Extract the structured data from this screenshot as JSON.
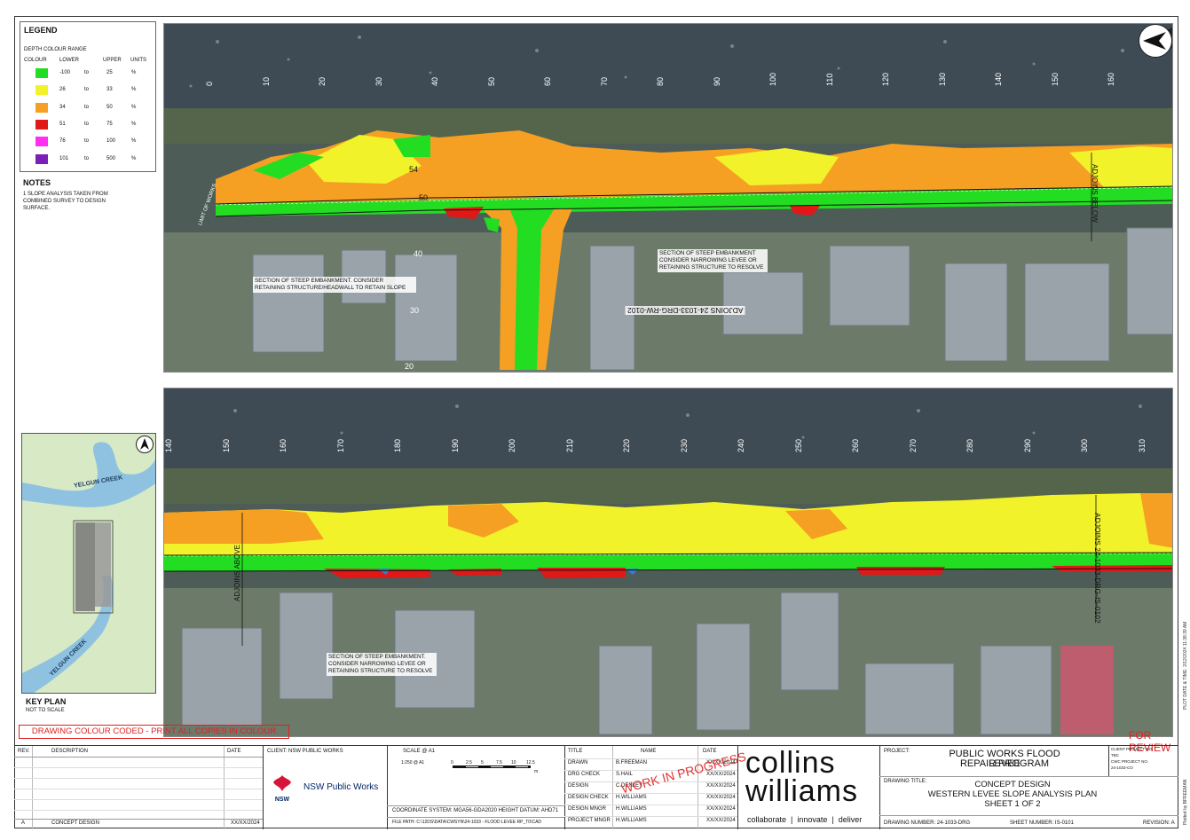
{
  "legend": {
    "title": "LEGEND",
    "subtitle": "DEPTH COLOUR RANGE",
    "headers": {
      "colour": "COLOUR",
      "lower": "LOWER",
      "upper": "UPPER",
      "units": "UNITS"
    },
    "rows": [
      {
        "color": "#22dd22",
        "lower": "-100",
        "to": "to",
        "upper": "25",
        "units": "%"
      },
      {
        "color": "#f2f22a",
        "lower": "26",
        "to": "to",
        "upper": "33",
        "units": "%"
      },
      {
        "color": "#f5a023",
        "lower": "34",
        "to": "to",
        "upper": "50",
        "units": "%"
      },
      {
        "color": "#e01818",
        "lower": "51",
        "to": "to",
        "upper": "75",
        "units": "%"
      },
      {
        "color": "#ff2ef0",
        "lower": "76",
        "to": "to",
        "upper": "100",
        "units": "%"
      },
      {
        "color": "#7a1fb8",
        "lower": "101",
        "to": "to",
        "upper": "500",
        "units": "%"
      }
    ]
  },
  "notes": {
    "title": "NOTES",
    "items": [
      "1   SLOPE ANALYSIS TAKEN FROM COMBINED SURVEY TO DESIGN SURFACE."
    ]
  },
  "top_panel": {
    "chainages": [
      "0",
      "10",
      "20",
      "30",
      "40",
      "50",
      "60",
      "70",
      "80",
      "90",
      "100",
      "110",
      "120",
      "130",
      "140",
      "150",
      "160"
    ],
    "road_chainages": [
      "54",
      "50",
      "40",
      "30",
      "20"
    ],
    "limit_label": "LIMIT OF WORKS",
    "adjoins_below": "ADJOINS BELOW",
    "adjoins_road": "ADJOINS 24-1033-DRG-RW-0102",
    "callout_1": "SECTION OF STEEP EMBANKMENT. CONSIDER RETAINING STRUCTURE/HEADWALL TO RETAIN SLOPE",
    "callout_2": "SECTION OF STEEP EMBANKMENT CONSIDER NARROWING LEVEE OR RETAINING STRUCTURE TO RESOLVE"
  },
  "bottom_panel": {
    "chainages": [
      "140",
      "150",
      "160",
      "170",
      "180",
      "190",
      "200",
      "210",
      "220",
      "230",
      "240",
      "250",
      "260",
      "270",
      "280",
      "290",
      "300",
      "310"
    ],
    "adjoins_above": "ADJOINS ABOVE",
    "adjoins_next": "ADJOINS 24-1033-DRG-IS-0102",
    "callout": "SECTION OF STEEP EMBANKMENT. CONSIDER NARROWING LEVEE OR RETAINING STRUCTURE TO RESOLVE"
  },
  "key_plan": {
    "title": "KEY PLAN",
    "subtitle": "NOT TO SCALE",
    "creek_1": "YELGUN CREEK",
    "creek_2": "YELGUN CREEK"
  },
  "colour_note": "DRAWING COLOUR CODED - PRINT ALL COPIES IN COLOUR",
  "for_review": "FOR REVIEW",
  "title_block": {
    "rev_header": "REV.",
    "desc_header": "DESCRIPTION",
    "date_header": "DATE",
    "rev_row": {
      "rev": "A",
      "desc": "CONCEPT DESIGN",
      "date": "XX/XX/2024"
    },
    "client_label": "CLIENT: NSW PUBLIC WORKS",
    "client_logo_text": "NSW Public Works",
    "nsw_text": "NSW",
    "gov_text": "GOVERNMENT",
    "scale_label": "SCALE @ A1",
    "scale_ratio": "1:250 @ A1",
    "scale_ticks": [
      "0",
      "2.5",
      "5",
      "7.5",
      "10",
      "12.5"
    ],
    "scale_unit": "m",
    "coord_system": "COORDINATE SYSTEM:  MGA56-GDA2020 HEIGHT DATUM:  AHD71",
    "file_path": "FILE PATH:  C:\\12DS\\DATA\\CWSYN\\24-1033 - FLOOD LEVEE RP_T0\\CAD",
    "staff_headers": {
      "title": "TITLE",
      "name": "NAME",
      "date": "DATE"
    },
    "staff": [
      {
        "title": "DRAWN",
        "name": "B.FREEMAN",
        "date": "XX/XX/2024"
      },
      {
        "title": "DRG CHECK",
        "name": "S.HAIL",
        "date": "XX/XX/2024"
      },
      {
        "title": "DESIGN",
        "name": "C.DENLEY",
        "date": "XX/XX/2024"
      },
      {
        "title": "DESIGN CHECK",
        "name": "H.WILLIAMS",
        "date": "XX/XX/2024"
      },
      {
        "title": "DESIGN MNGR",
        "name": "H.WILLIAMS",
        "date": "XX/XX/2024"
      },
      {
        "title": "PROJECT MNGR",
        "name": "H.WILLIAMS",
        "date": "XX/XX/2024"
      }
    ],
    "work_in_progress": "WORK IN PROGRESS",
    "brand_line1": "collins",
    "brand_line2": "williams",
    "brand_tagline": "collaborate  |  innovate  |  deliver",
    "project_label": "PROJECT:",
    "project_name_1": "PUBLIC WORKS FLOOD LEVEE",
    "project_name_2": "REPAIR PROGRAM",
    "drawing_title_label": "DRAWING TITLE:",
    "drawing_title_1": "CONCEPT DESIGN",
    "drawing_title_2": "WESTERN LEVEE SLOPE ANALYSIS PLAN",
    "drawing_title_3": "SHEET 1 OF 2",
    "client_project_label": "CLIENT PROJECT NO.",
    "client_project_value": "TBC",
    "cwc_project_label": "CWC PROJECT NO.",
    "cwc_project_value": "24-1033-CO",
    "drawing_number": "DRAWING NUMBER:  24-1033-DRG",
    "sheet_number": "SHEET NUMBER:  IS-0101",
    "revision": "REVISION:  A",
    "plot_date": "PLOT DATE & TIME:  2/12/2024 11:38:39 AM",
    "plotted_by": "Plotted by BFREEMAN"
  }
}
